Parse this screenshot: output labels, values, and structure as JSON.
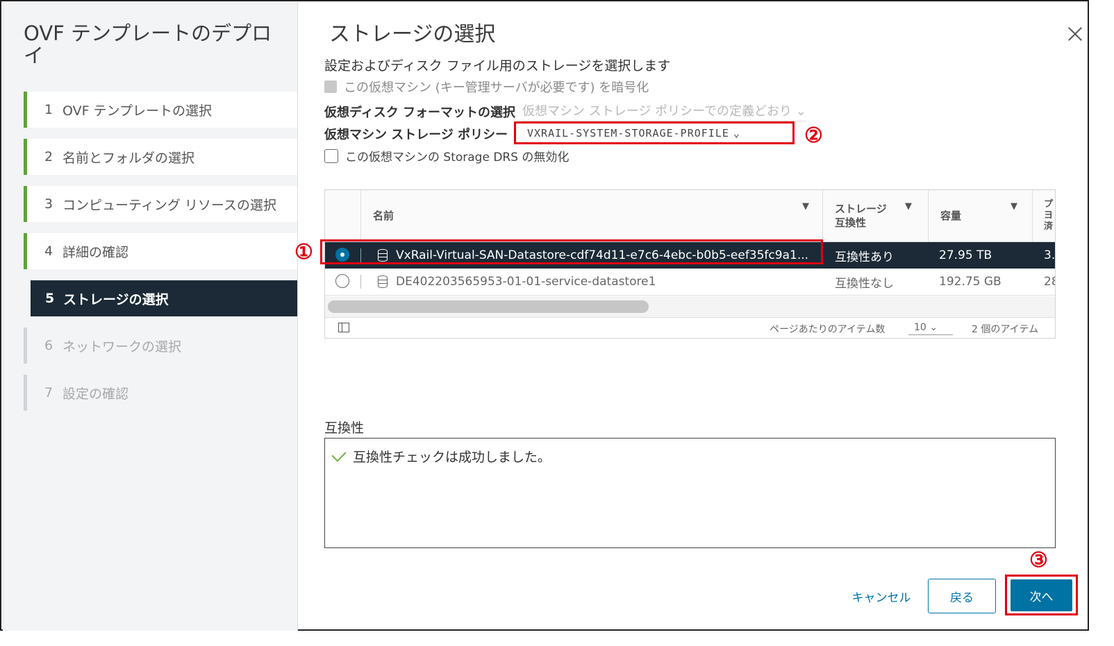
{
  "sidebar": {
    "title": "OVF テンプレートのデプロイ",
    "steps": [
      {
        "num": "1",
        "label": "OVF テンプレートの選択"
      },
      {
        "num": "2",
        "label": "名前とフォルダの選択"
      },
      {
        "num": "3",
        "label": "コンピューティング リソースの選択"
      },
      {
        "num": "4",
        "label": "詳細の確認"
      },
      {
        "num": "5",
        "label": "ストレージの選択"
      },
      {
        "num": "6",
        "label": "ネットワークの選択"
      },
      {
        "num": "7",
        "label": "設定の確認"
      }
    ]
  },
  "main": {
    "title": "ストレージの選択",
    "subtitle": "設定およびディスク ファイル用のストレージを選択します",
    "encrypt_label": "この仮想マシン (キー管理サーバが必要です) を暗号化",
    "disk_format_label": "仮想ディスク フォーマットの選択",
    "disk_format_value": "仮想マシン ストレージ ポリシーでの定義どおり",
    "policy_label": "仮想マシン ストレージ ポリシー",
    "policy_value": "VXRAIL-SYSTEM-STORAGE-PROFILE",
    "drs_label": "この仮想マシンの Storage DRS の無効化"
  },
  "table": {
    "columns": [
      "名前",
      "ストレージ\n互換性",
      "容量",
      "プ\nヨ\n済"
    ],
    "rows": [
      {
        "name": "VxRail-Virtual-SAN-Datastore-cdf74d11-e7c6-4ebc-b0b5-eef35fc9a1...",
        "compat": "互換性あり",
        "capacity": "27.95 TB",
        "extra": "3.",
        "selected": true
      },
      {
        "name": "DE402203565953-01-01-service-datastore1",
        "compat": "互換性なし",
        "capacity": "192.75 GB",
        "extra": "28",
        "selected": false
      }
    ],
    "per_page_label": "ページあたりのアイテム数",
    "per_page_value": "10",
    "count_label": "2 個のアイテム"
  },
  "compatibility": {
    "label": "互換性",
    "message": "互換性チェックは成功しました。"
  },
  "buttons": {
    "cancel": "キャンセル",
    "back": "戻る",
    "next": "次へ"
  },
  "annotations": {
    "one": "①",
    "two": "②",
    "three": "③"
  },
  "colors": {
    "accent": "#0072a3",
    "selected_row": "#1b2a36",
    "annotation_red": "#e00010",
    "step_done_green": "#61a03f"
  }
}
